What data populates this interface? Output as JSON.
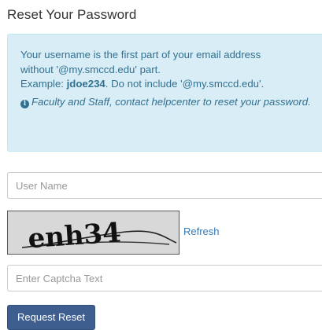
{
  "page": {
    "title": "Reset Your Password"
  },
  "info": {
    "line1": "Your username is the first part of your email address",
    "line2": "without '@my.smccd.edu' part.",
    "example_prefix": "Example: ",
    "example_user": "jdoe234",
    "example_suffix": ". Do not include '@my.smccd.edu'.",
    "note": "Faculty and Staff, contact helpcenter to reset your password.",
    "icon": "info-circle-icon"
  },
  "form": {
    "username_placeholder": "User Name",
    "username_value": "",
    "captcha_image_text": "enh34",
    "refresh_label": "Refresh",
    "captcha_placeholder": "Enter Captcha Text",
    "captcha_value": "",
    "submit_label": "Request Reset"
  },
  "colors": {
    "info_bg": "#d9edf7",
    "info_text": "#31708f",
    "link": "#337ab7",
    "button": "#3d5e8e"
  }
}
